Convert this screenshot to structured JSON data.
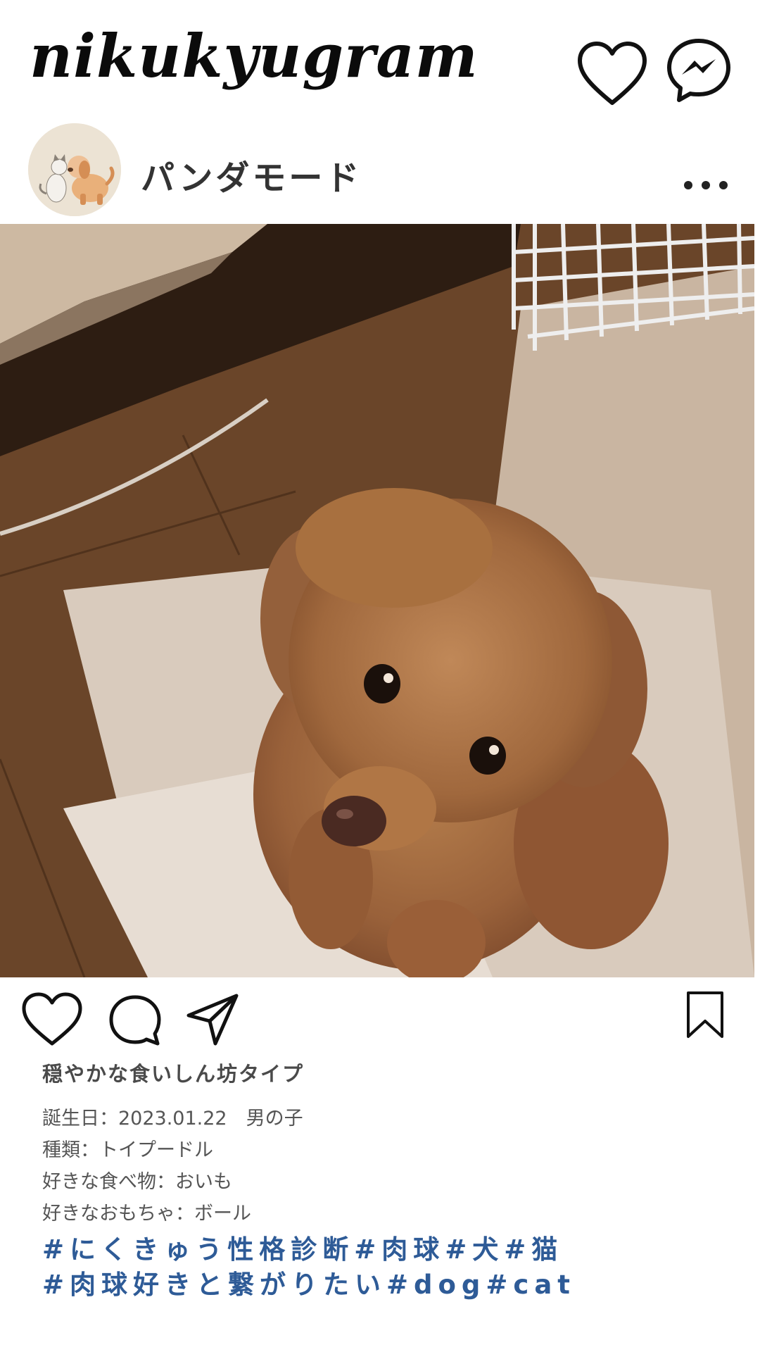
{
  "app": {
    "logo": "nikukyugram",
    "accent_color": "#2e5b97",
    "header_icons": [
      "heart-icon",
      "messenger-icon"
    ]
  },
  "post": {
    "username": "パンダモード",
    "avatar": "dog-and-cat-illustration",
    "photo": "toy-poodle-photo",
    "action_icons": [
      "heart-icon",
      "comment-icon",
      "share-icon",
      "bookmark-icon"
    ],
    "type_title": "穏やかな食いしん坊タイプ",
    "info": [
      "誕生日：2023.01.22　男の子",
      "種類：トイプードル",
      "好きな食べ物：おいも",
      "好きなおもちゃ：ボール"
    ],
    "hashtags": [
      "#にくきゅう性格診断#肉球#犬#猫",
      "#肉球好きと繋がりたい#dog#cat"
    ]
  }
}
